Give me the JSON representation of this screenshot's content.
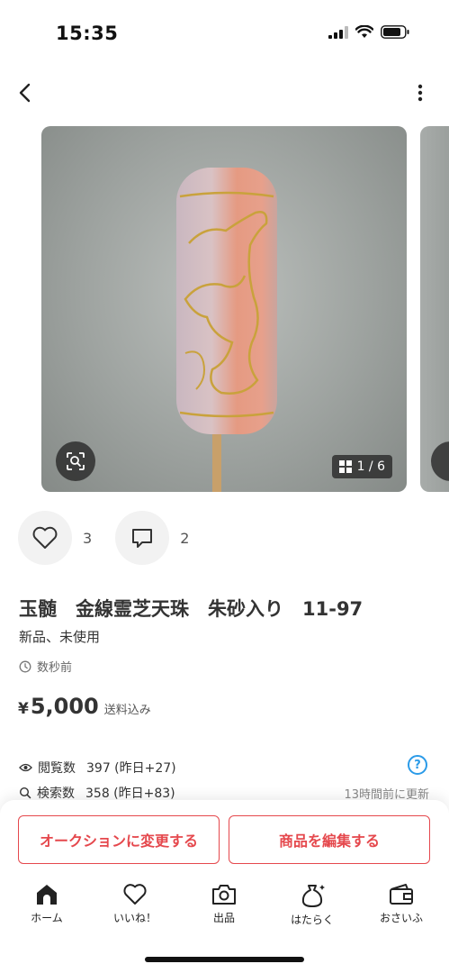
{
  "status_bar": {
    "time": "15:35"
  },
  "gallery": {
    "page_counter": "1 / 6"
  },
  "actions": {
    "like_count": "3",
    "comment_count": "2"
  },
  "item": {
    "title": "玉髄　金線霊芝天珠　朱砂入り　11-97",
    "condition": "新品、未使用",
    "posted": "数秒前",
    "price_symbol": "¥",
    "price": "5,000",
    "shipping_note": "送料込み"
  },
  "stats": {
    "views_label": "閲覧数",
    "views_value": "397 (昨日+27)",
    "search_label": "検索数",
    "search_value": "358 (昨日+83)",
    "update_note": "13時間前に更新"
  },
  "buttons": {
    "auction": "オークションに変更する",
    "edit": "商品を編集する"
  },
  "tabbar": {
    "items": [
      {
        "label": "ホーム",
        "icon": "home-icon"
      },
      {
        "label": "いいね！",
        "icon": "heart-icon"
      },
      {
        "label": "出品",
        "icon": "camera-icon"
      },
      {
        "label": "はたらく",
        "icon": "money-bag-icon"
      },
      {
        "label": "おさいふ",
        "icon": "wallet-icon"
      }
    ]
  },
  "colors": {
    "accent": "#e5484d",
    "help": "#2b9be8"
  }
}
